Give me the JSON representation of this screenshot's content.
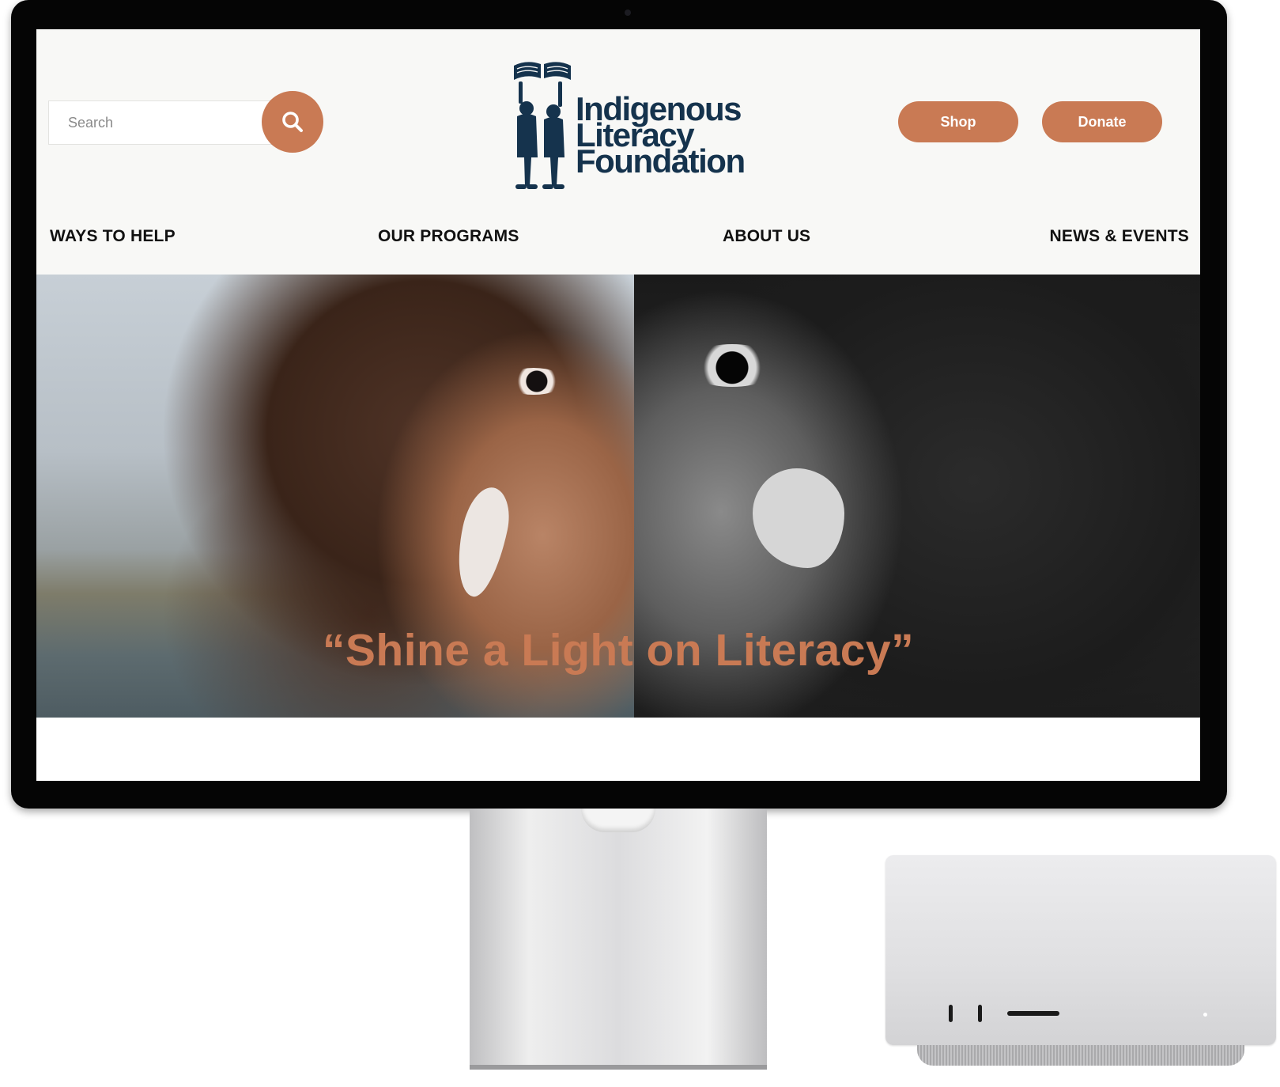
{
  "search": {
    "placeholder": "Search"
  },
  "logo": {
    "line1": "Indigenous",
    "line2": "Literacy",
    "line3": "Foundation"
  },
  "header_buttons": {
    "shop": "Shop",
    "donate": "Donate"
  },
  "nav": {
    "items": [
      {
        "label": "WAYS TO HELP"
      },
      {
        "label": "OUR PROGRAMS"
      },
      {
        "label": "ABOUT US"
      },
      {
        "label": "NEWS & EVENTS"
      }
    ]
  },
  "hero": {
    "caption": "“Shine a Light on Literacy”"
  },
  "icons": {
    "search": "search-icon",
    "logo_mark": "children-holding-book-icon"
  },
  "colors": {
    "accent": "#c97a54",
    "logo_navy": "#15334d",
    "header_bg": "#f8f8f6",
    "nav_text": "#111111"
  }
}
